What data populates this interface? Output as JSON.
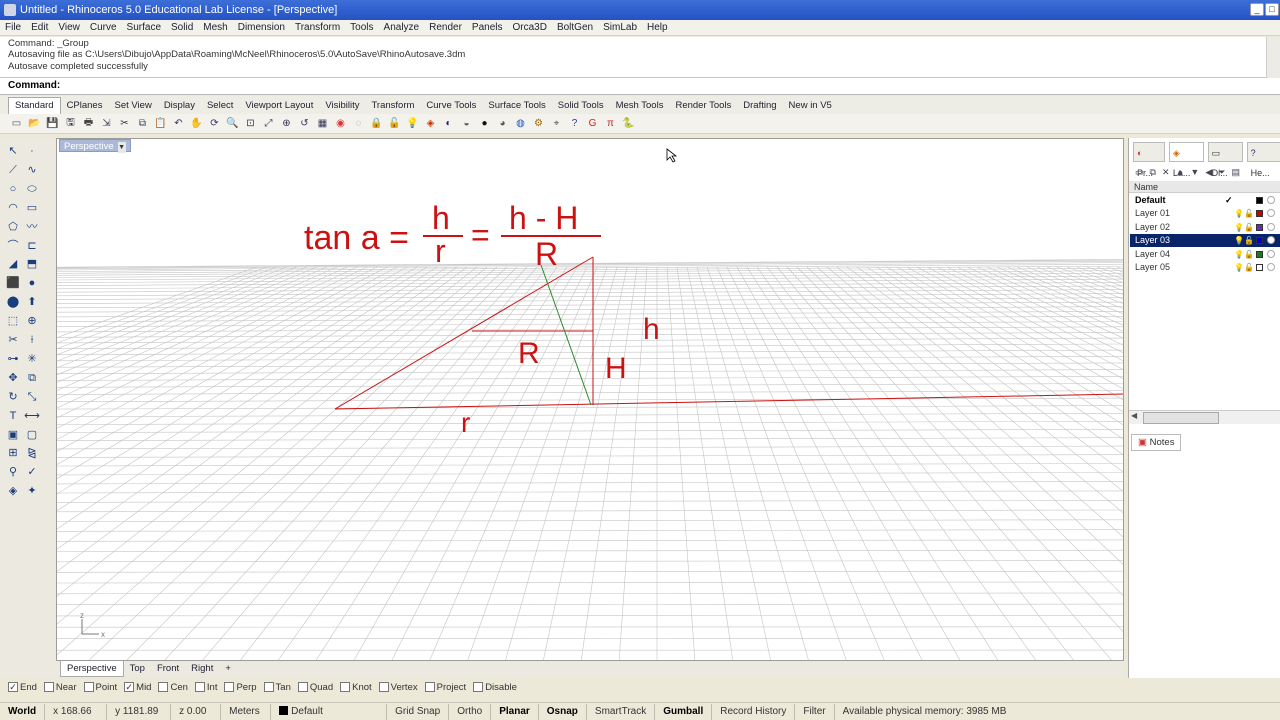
{
  "window": {
    "title": "Untitled - Rhinoceros 5.0 Educational Lab License - [Perspective]"
  },
  "menu": [
    "File",
    "Edit",
    "View",
    "Curve",
    "Surface",
    "Solid",
    "Mesh",
    "Dimension",
    "Transform",
    "Tools",
    "Analyze",
    "Render",
    "Panels",
    "Orca3D",
    "BoltGen",
    "SimLab",
    "Help"
  ],
  "command_history": {
    "line1": "Command: _Group",
    "line2": "Autosaving file as C:\\Users\\Dibujo\\AppData\\Roaming\\McNeel\\Rhinoceros\\5.0\\AutoSave\\RhinoAutosave.3dm",
    "line3": "Autosave completed successfully"
  },
  "command_prompt": "Command:",
  "toolbar_tabs": [
    "Standard",
    "CPlanes",
    "Set View",
    "Display",
    "Select",
    "Viewport Layout",
    "Visibility",
    "Transform",
    "Curve Tools",
    "Surface Tools",
    "Solid Tools",
    "Mesh Tools",
    "Render Tools",
    "Drafting",
    "New in V5"
  ],
  "toolbar_icons": [
    "new-file-icon",
    "open-file-icon",
    "save-icon",
    "save-as-icon",
    "print-icon",
    "import-icon",
    "cut-icon",
    "copy-icon",
    "paste-icon",
    "undo-icon",
    "pan-icon",
    "rotate-view-icon",
    "zoom-dynamic-icon",
    "zoom-window-icon",
    "zoom-extents-icon",
    "zoom-selected-icon",
    "undo-view-icon",
    "grid-icon",
    "show-icon",
    "hide-icon",
    "lock-icon",
    "unlock-icon",
    "lightbulb-icon",
    "layer-icon",
    "shade-icon",
    "render-preview-icon",
    "sphere-icon",
    "rendered-icon",
    "material-icon",
    "options-icon",
    "snap-icon",
    "help-icon",
    "grasshopper-icon",
    "pi-icon",
    "python-icon"
  ],
  "viewport": {
    "label": "Perspective",
    "formula": {
      "left": "tan a =",
      "num1": "h",
      "den1": "r",
      "eq": "=",
      "num2": "h - H",
      "den2": "R"
    },
    "labels": {
      "h": "h",
      "R": "R",
      "H": "H",
      "r": "r"
    },
    "axis_x": "x",
    "axis_z": "z"
  },
  "viewport_tabs": [
    "Perspective",
    "Top",
    "Front",
    "Right"
  ],
  "panel": {
    "tabs": [
      "Pr...",
      "La...",
      "Di...",
      "He..."
    ],
    "column_name": "Name",
    "layers": [
      {
        "name": "Default",
        "current": "✓",
        "color": "#000000"
      },
      {
        "name": "Layer 01",
        "current": "",
        "color": "#cc0000"
      },
      {
        "name": "Layer 02",
        "current": "",
        "color": "#6a2bb0"
      },
      {
        "name": "Layer 03",
        "current": "",
        "color": "#0000cc"
      },
      {
        "name": "Layer 04",
        "current": "",
        "color": "#1e7a1e"
      },
      {
        "name": "Layer 05",
        "current": "",
        "color": "#ffffff"
      }
    ],
    "notes_tab": "Notes"
  },
  "osnaps": [
    {
      "label": "End",
      "checked": true
    },
    {
      "label": "Near",
      "checked": false
    },
    {
      "label": "Point",
      "checked": false
    },
    {
      "label": "Mid",
      "checked": true
    },
    {
      "label": "Cen",
      "checked": false
    },
    {
      "label": "Int",
      "checked": false
    },
    {
      "label": "Perp",
      "checked": false
    },
    {
      "label": "Tan",
      "checked": false
    },
    {
      "label": "Quad",
      "checked": false
    },
    {
      "label": "Knot",
      "checked": false
    },
    {
      "label": "Vertex",
      "checked": false
    },
    {
      "label": "Project",
      "checked": false
    },
    {
      "label": "Disable",
      "checked": false
    }
  ],
  "status": {
    "world": "World",
    "x": "x 168.66",
    "y": "y 1181.89",
    "z": "z 0.00",
    "units": "Meters",
    "layer": "Default",
    "grid_snap": "Grid Snap",
    "ortho": "Ortho",
    "planar": "Planar",
    "osnap": "Osnap",
    "smarttrack": "SmartTrack",
    "gumball": "Gumball",
    "record_history": "Record History",
    "filter": "Filter",
    "memory": "Available physical memory: 3985 MB"
  },
  "colors": {
    "drawing_red": "#cc1111",
    "line_green": "#2a8a2a",
    "selected_row": "#0a246a"
  }
}
